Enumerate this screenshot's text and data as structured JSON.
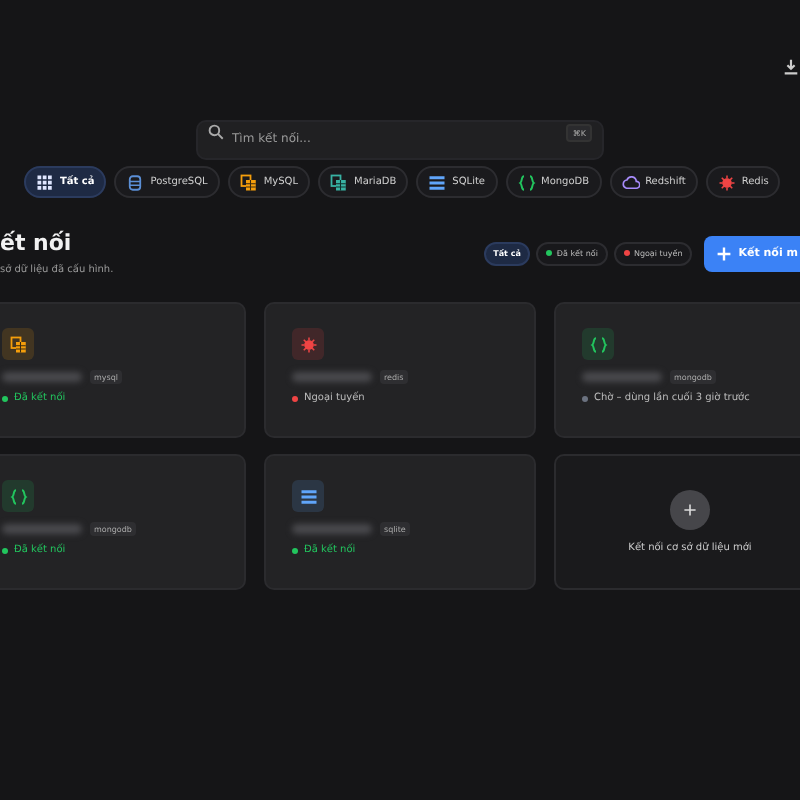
{
  "search": {
    "placeholder": "Tìm kết nối...",
    "shortcut": "⌘K"
  },
  "db_filters": [
    {
      "label": "Tất cả",
      "kind": "all",
      "selected": true
    },
    {
      "label": "PostgreSQL",
      "kind": "postgres",
      "selected": false
    },
    {
      "label": "MySQL",
      "kind": "mysql",
      "selected": false
    },
    {
      "label": "MariaDB",
      "kind": "mariadb",
      "selected": false
    },
    {
      "label": "SQLite",
      "kind": "sqlite",
      "selected": false
    },
    {
      "label": "MongoDB",
      "kind": "mongodb",
      "selected": false
    },
    {
      "label": "Redshift",
      "kind": "redshift",
      "selected": false
    },
    {
      "label": "Redis",
      "kind": "redis",
      "selected": false
    }
  ],
  "header": {
    "title": "ết nối",
    "subtitle": "sở dữ liệu đã cấu hình."
  },
  "status_filters": [
    {
      "label": "Tất cả",
      "selected": true
    },
    {
      "label": "Đã kết nối",
      "color": "#22c55e",
      "selected": false
    },
    {
      "label": "Ngoại tuyến",
      "color": "#ef4444",
      "selected": false
    }
  ],
  "new_button": "Kết nối m",
  "connections": [
    {
      "kind": "mysql",
      "tag": "mysql",
      "status": {
        "kind": "connected",
        "text": "Đã kết nối"
      }
    },
    {
      "kind": "redis",
      "tag": "redis",
      "status": {
        "kind": "offline",
        "text": "Ngoại tuyến"
      }
    },
    {
      "kind": "mongodb",
      "tag": "mongodb",
      "status": {
        "kind": "idle",
        "text": "Chờ – dùng lần cuối 3 giờ trước"
      }
    },
    {
      "kind": "mongodb",
      "tag": "mongodb",
      "status": {
        "kind": "connected",
        "text": "Đã kết nối"
      }
    },
    {
      "kind": "sqlite",
      "tag": "sqlite",
      "status": {
        "kind": "connected",
        "text": "Đã kết nối"
      }
    }
  ],
  "add_card": {
    "label": "Kết nối cơ sở dữ liệu mới"
  }
}
